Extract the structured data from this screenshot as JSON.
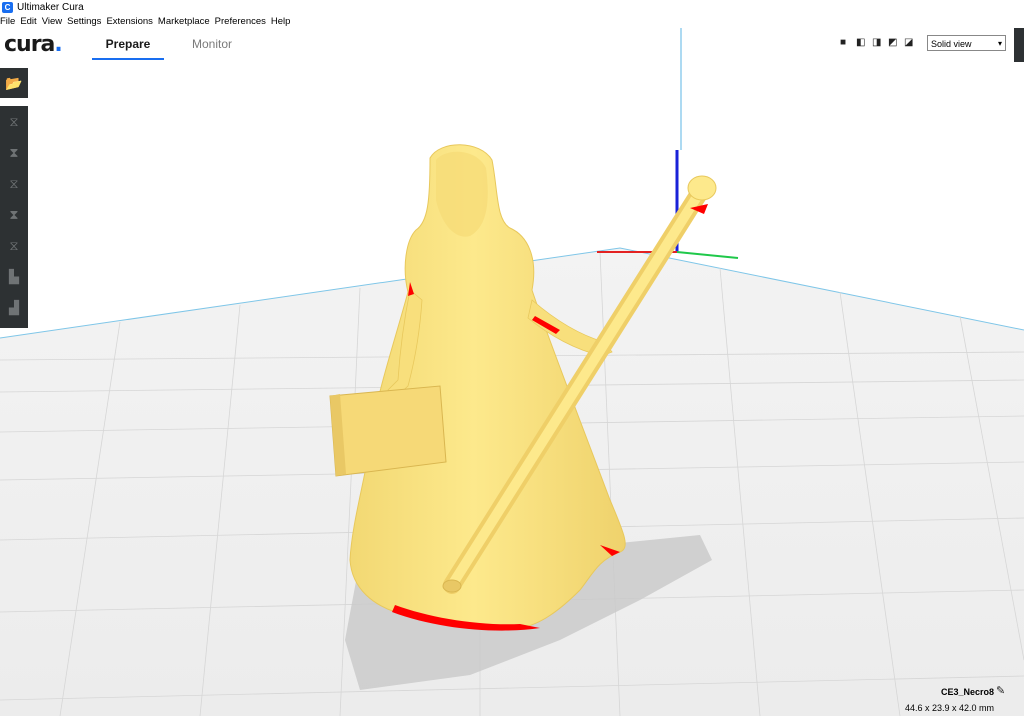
{
  "window": {
    "title": "Ultimaker Cura"
  },
  "menu": [
    "File",
    "Edit",
    "View",
    "Settings",
    "Extensions",
    "Marketplace",
    "Preferences",
    "Help"
  ],
  "header": {
    "logo_text": "cura",
    "logo_dot": ".",
    "tabs": {
      "prepare": "Prepare",
      "monitor": "Monitor"
    },
    "view_select": {
      "value": "Solid view"
    }
  },
  "colors": {
    "accent": "#196ef0",
    "model": "#fde789",
    "toolbar": "#2d3133",
    "overhang": "#ff0000"
  },
  "sidebar": {
    "open_icon": "folder-open-icon",
    "tools": [
      "move-icon",
      "scale-icon",
      "rotate-icon",
      "mirror-icon",
      "per-model-settings-icon",
      "support-blocker-icon",
      "layer-icon"
    ]
  },
  "object_info": {
    "name": "CE3_Necro8",
    "dimensions": "44.6 x 23.9 x 42.0 mm"
  }
}
